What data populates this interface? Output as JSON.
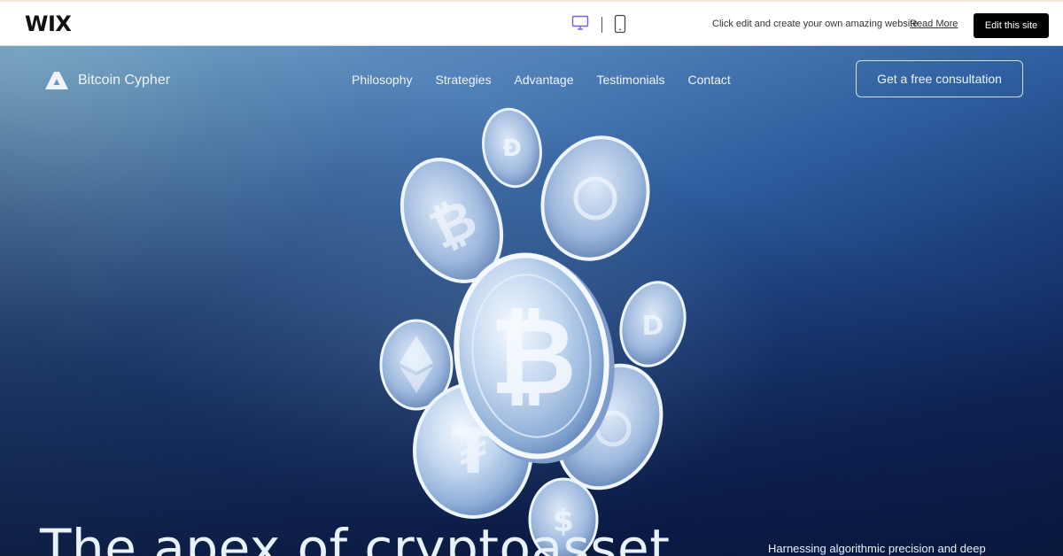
{
  "wix_bar": {
    "logo": "WIX",
    "message": "Click edit and create your own amazing website",
    "read_more": "Read More",
    "edit_button": "Edit this site",
    "devices": [
      "desktop-icon",
      "mobile-icon"
    ],
    "accent_color": "#7a5cd6"
  },
  "site": {
    "brand": "Bitcoin Cypher",
    "nav": [
      "Philosophy",
      "Strategies",
      "Advantage",
      "Testimonials",
      "Contact"
    ],
    "cta": "Get a free consultation"
  },
  "hero": {
    "headline": "The apex of cryptoasset",
    "subtext": "Harnessing algorithmic precision and deep",
    "image": "coins-illustration"
  },
  "colors": {
    "hero_light": "#8fbad8",
    "hero_dark": "#0a1a40",
    "text": "#eef4fb"
  }
}
